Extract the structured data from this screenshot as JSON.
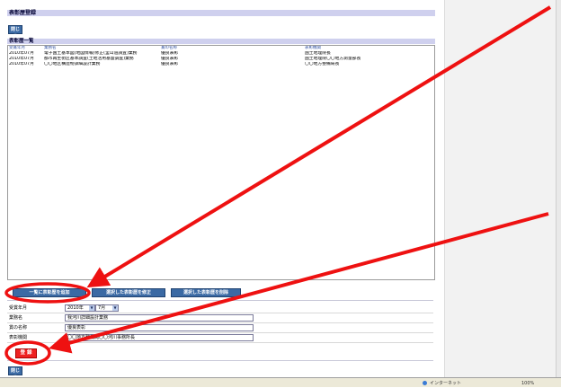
{
  "page": {
    "title": "表彰歴登録",
    "close_label": "閉じる",
    "list_title": "表彰歴一覧"
  },
  "list": {
    "columns": [
      "受賞年月",
      "業務名",
      "賞の名称",
      "表彰機関"
    ],
    "rows": [
      {
        "date": "2010年07月",
        "work": "電子国土基本図(地図情報)修正(釜山道調査)業務",
        "award": "優良表彰",
        "org": "国土地理院長"
      },
      {
        "date": "2010年07月",
        "work": "都市再生街区基本調査(土地活用基盤調査)業務",
        "award": "優良表彰",
        "org": "国土地理院〇〇地方測量部長"
      },
      {
        "date": "2010年07月",
        "work": "〇〇地区構造物詳細設計業務",
        "award": "優良表彰",
        "org": "〇〇地方整備局長"
      }
    ]
  },
  "actions": {
    "add": "一覧に表彰歴を追加",
    "edit": "選択した表彰歴を修正",
    "delete": "選択した表彰歴を削除"
  },
  "form": {
    "date_label": "受賞年月",
    "year_value": "2010年",
    "month_value": "7月",
    "work_label": "業務名",
    "work_value": "我河川詳細設計業務",
    "award_label": "賞の名称",
    "award_value": "優良表彰",
    "org_label": "表彰機関",
    "org_value": "〇〇地方整備局〇〇河川事務所長"
  },
  "register_label": "登 録",
  "footer_close_label": "閉じる",
  "status": {
    "zone": "インターネット",
    "zoom": "100%"
  },
  "colors": {
    "header_band": "#cfd0ee",
    "button_blue": "#3b6aa4",
    "highlight_red": "#ee1111"
  }
}
